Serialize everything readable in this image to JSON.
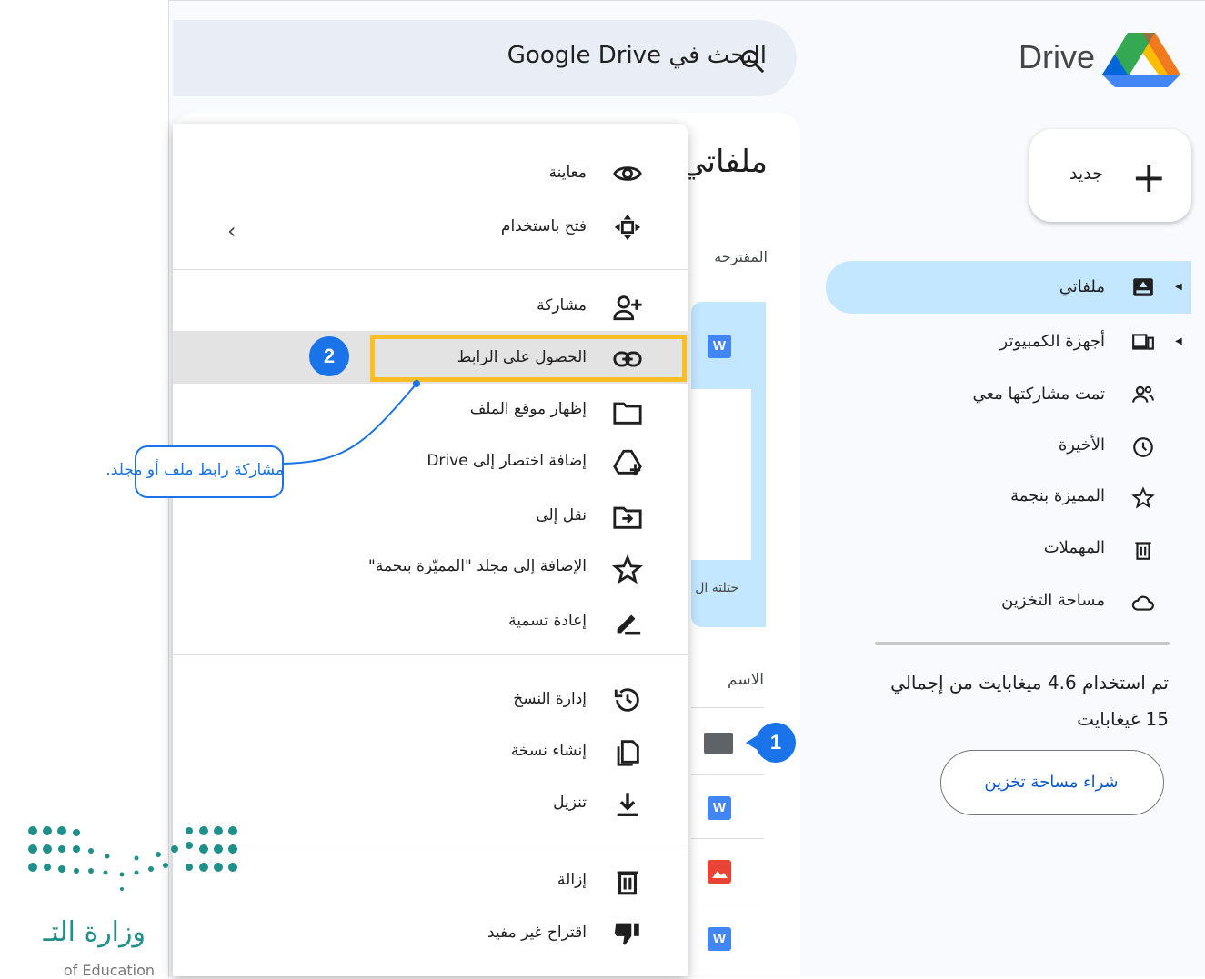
{
  "app": {
    "logo_text": "Drive"
  },
  "search": {
    "placeholder": "البحث في Google Drive"
  },
  "sidebar": {
    "new_label": "جديد",
    "items": [
      {
        "label": "ملفاتي",
        "icon": "my-drive-icon",
        "active": true
      },
      {
        "label": "أجهزة الكمبيوتر",
        "icon": "computers-icon"
      },
      {
        "label": "تمت مشاركتها معي",
        "icon": "shared-people-icon"
      },
      {
        "label": "الأخيرة",
        "icon": "clock-icon"
      },
      {
        "label": "المميزة بنجمة",
        "icon": "star-icon"
      },
      {
        "label": "المهملات",
        "icon": "trash-icon"
      },
      {
        "label": "مساحة التخزين",
        "icon": "cloud-icon"
      }
    ],
    "storage_line1": "تم استخدام 4.6 ميغابايت من إجمالي",
    "storage_line2": "15 غيغابايت",
    "buy_storage": "شراء مساحة تخزين"
  },
  "main": {
    "title": "ملفاتي",
    "suggested": "المقترحة",
    "card_text": "حتلته ال",
    "column_name": "الاسم"
  },
  "context_menu": {
    "items": [
      {
        "label": "معاينة",
        "icon": "eye-icon"
      },
      {
        "label": "فتح باستخدام",
        "icon": "open-with-icon",
        "submenu": true
      },
      {
        "label": "مشاركة",
        "icon": "person-add-icon"
      },
      {
        "label": "الحصول على الرابط",
        "icon": "link-icon",
        "highlighted": true
      },
      {
        "label": "إظهار موقع الملف",
        "icon": "folder-icon"
      },
      {
        "label": "إضافة اختصار إلى Drive",
        "icon": "drive-shortcut-icon"
      },
      {
        "label": "نقل إلى",
        "icon": "move-to-icon"
      },
      {
        "label": "الإضافة إلى مجلد \"المميّزة بنجمة\"",
        "icon": "star-icon"
      },
      {
        "label": "إعادة تسمية",
        "icon": "rename-icon"
      },
      {
        "label": "إدارة النسخ",
        "icon": "history-icon"
      },
      {
        "label": "إنشاء نسخة",
        "icon": "copy-icon"
      },
      {
        "label": "تنزيل",
        "icon": "download-icon"
      },
      {
        "label": "إزالة",
        "icon": "trash-icon"
      },
      {
        "label": "اقتراح غير مفيد",
        "icon": "thumb-down-icon"
      }
    ]
  },
  "annotations": {
    "step1": "1",
    "step2": "2",
    "callout": "مشاركة رابط ملف أو مجلد."
  },
  "footer": {
    "ministry": "وزارة التـ",
    "ministry_en": "of Education"
  },
  "colors": {
    "accent": "#1a73e8",
    "highlight": "#fbbf24",
    "nav_active": "#c2e7ff"
  }
}
